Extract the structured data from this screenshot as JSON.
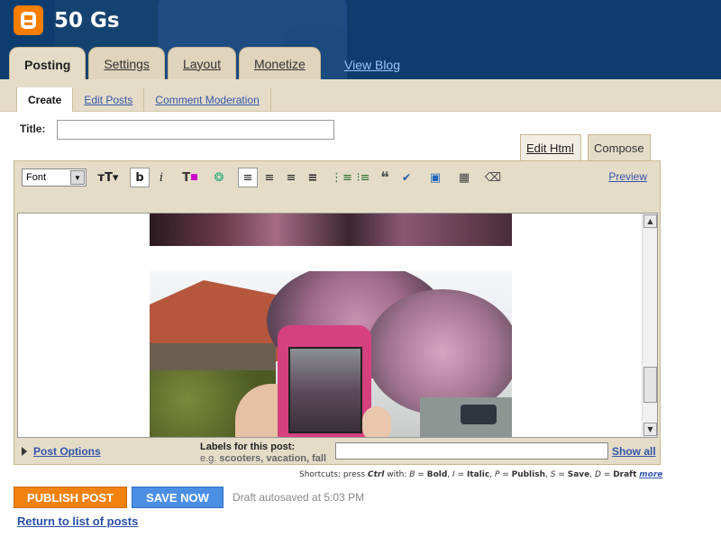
{
  "header": {
    "blog_title": "50 Gs",
    "view_blog": "View Blog"
  },
  "tabs": [
    {
      "label": "Posting"
    },
    {
      "label": "Settings"
    },
    {
      "label": "Layout"
    },
    {
      "label": "Monetize"
    }
  ],
  "subtabs": [
    {
      "label": "Create"
    },
    {
      "label": "Edit Posts"
    },
    {
      "label": "Comment Moderation"
    }
  ],
  "title_field": {
    "label": "Title:",
    "value": ""
  },
  "editor_modes": {
    "html": "Edit Html",
    "compose": "Compose"
  },
  "toolbar": {
    "font_select": "Font",
    "preview": "Preview",
    "icons": [
      "font-size-icon",
      "bold-icon",
      "italic-icon",
      "text-color-icon",
      "link-icon",
      "align-left-icon",
      "align-center-icon",
      "align-right-icon",
      "justify-icon",
      "numbered-list-icon",
      "bullet-list-icon",
      "blockquote-icon",
      "spellcheck-icon",
      "image-icon",
      "video-icon",
      "remove-formatting-icon"
    ]
  },
  "options": {
    "post_options": "Post Options",
    "labels_title": "Labels for this post:",
    "labels_hint_prefix": "e.g.",
    "labels_hint_examples": "scooters, vacation, fall",
    "labels_value": "",
    "show_all": "Show all"
  },
  "shortcuts": {
    "prefix": "Shortcuts: press",
    "key": "Ctrl",
    "with": "with:",
    "b": "B",
    "b_label": "Bold",
    "i": "I",
    "i_label": "Italic",
    "p": "P",
    "p_label": "Publish",
    "s": "S",
    "s_label": "Save",
    "d": "D",
    "d_label": "Draft",
    "more": "more"
  },
  "actions": {
    "publish": "PUBLISH POST",
    "save": "SAVE NOW",
    "autosave_status": "Draft autosaved at 5:03 PM",
    "return": "Return to list of posts"
  },
  "colors": {
    "header_bg": "#0c3d6e",
    "tab_bg": "#e0d4bc",
    "publish_bg": "#f2820f",
    "save_bg": "#4a8fe3",
    "link": "#3355aa"
  }
}
